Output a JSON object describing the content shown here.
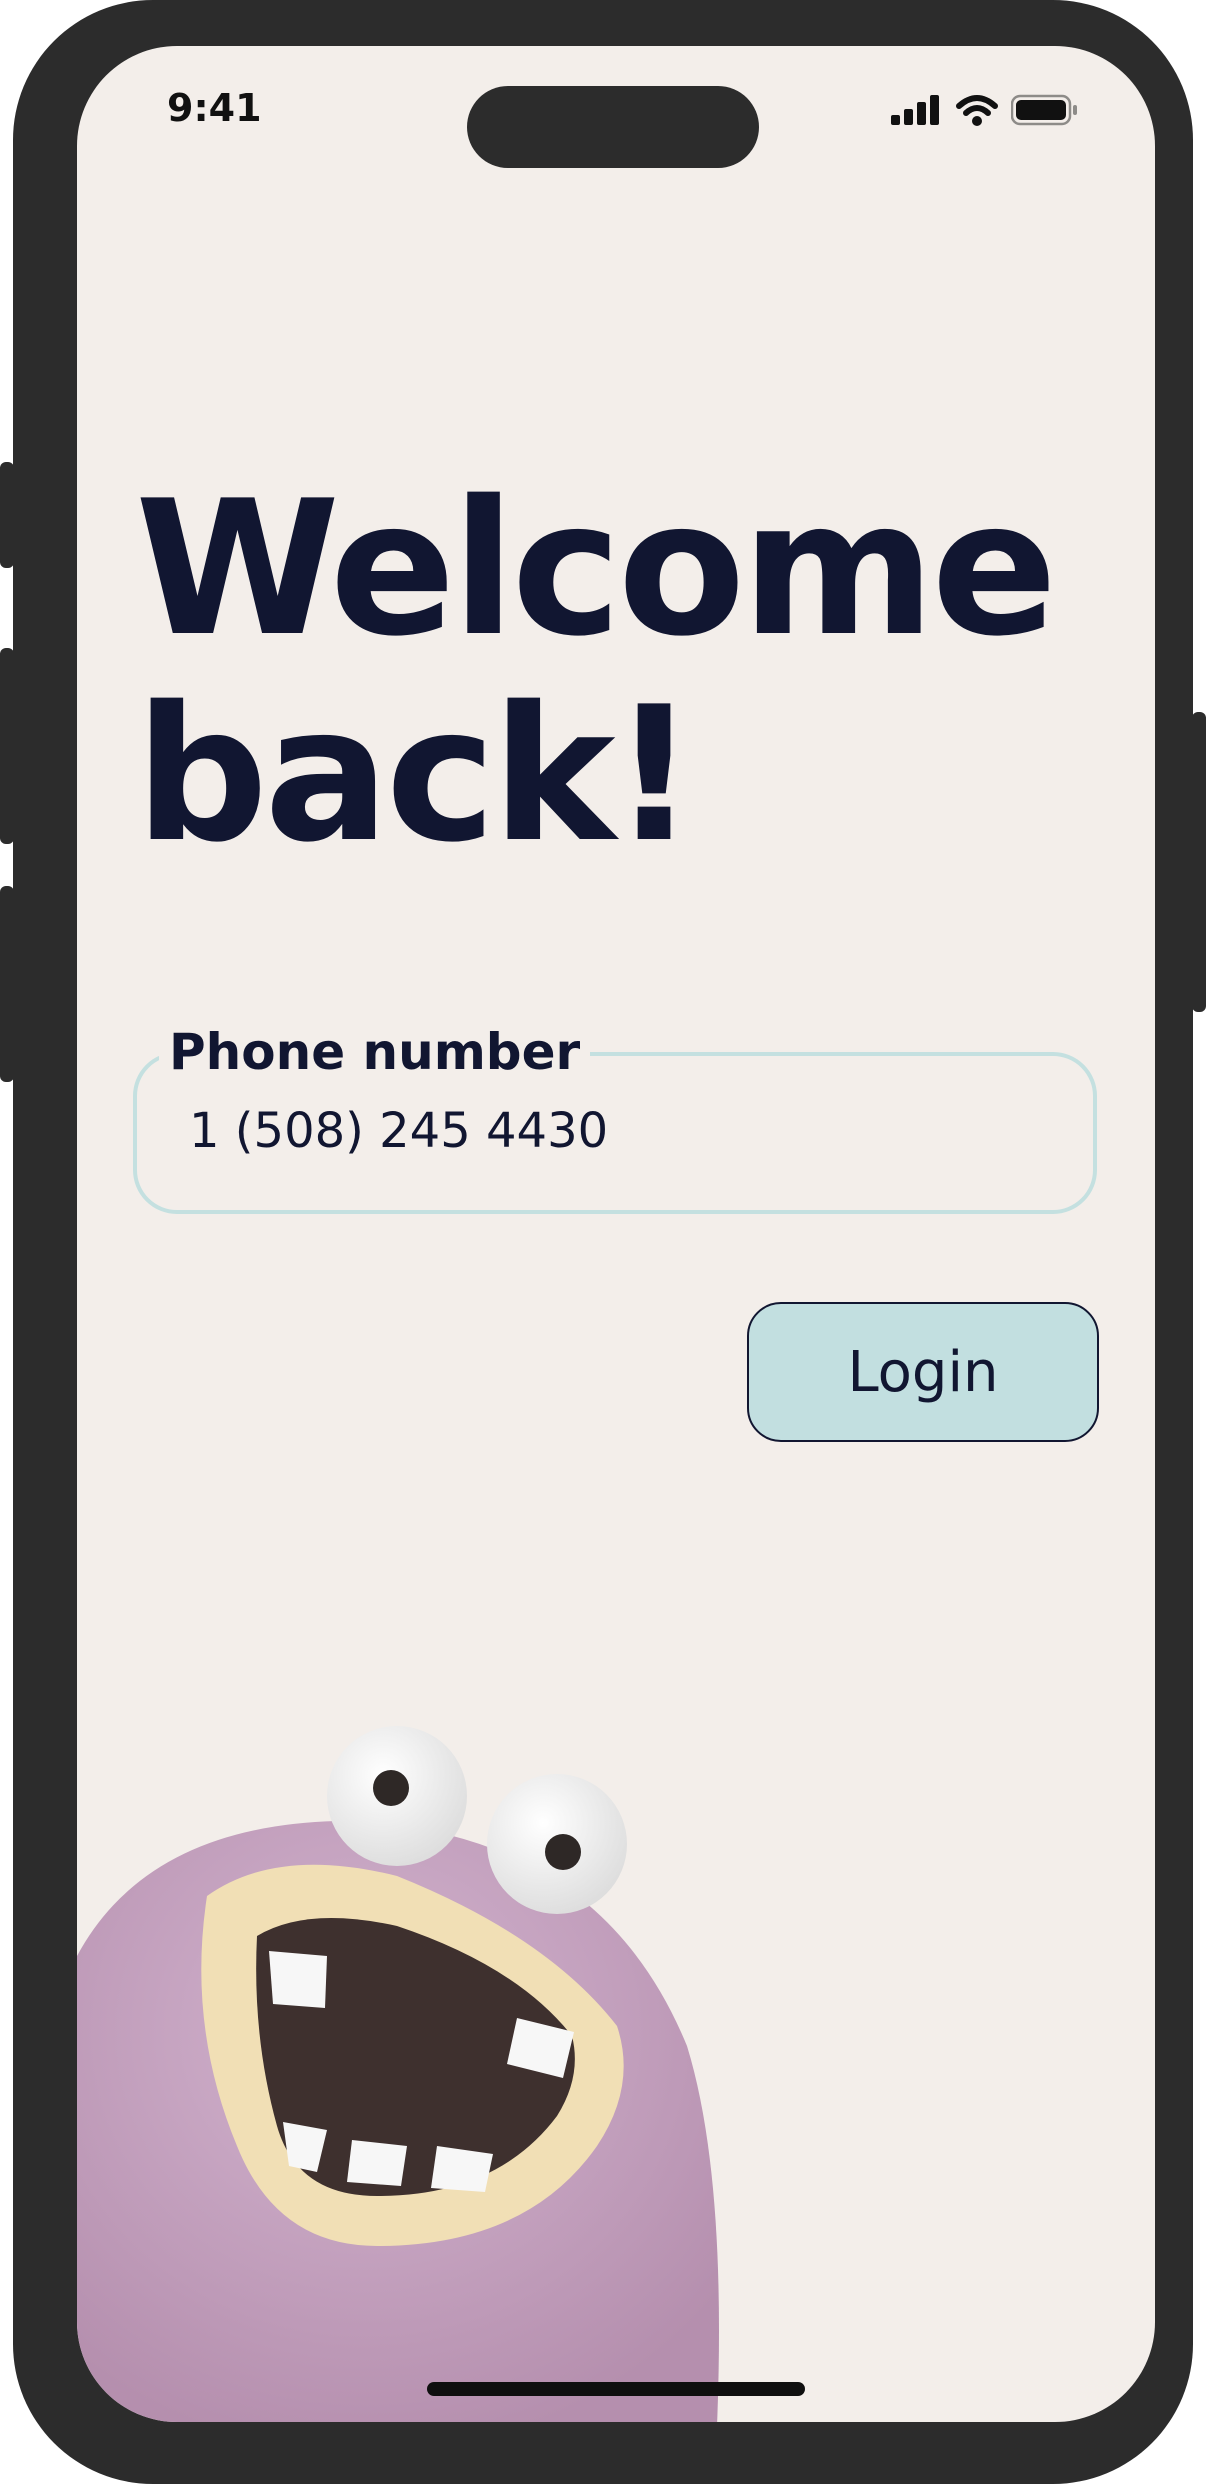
{
  "status_bar": {
    "time": "9:41",
    "icons": [
      "signal-icon",
      "wifi-icon",
      "battery-icon"
    ]
  },
  "welcome": {
    "line1": "Welcome",
    "line2": "back!"
  },
  "phone_field": {
    "label": "Phone number",
    "value": "1 (508) 245 4430"
  },
  "login_button": {
    "label": "Login"
  },
  "colors": {
    "background": "#f3eeea",
    "text": "#111631",
    "accent": "#c2dfe0",
    "field_border": "#c4e0e0",
    "frame": "#2c2c2c",
    "mascot": "#c4a2bf"
  }
}
